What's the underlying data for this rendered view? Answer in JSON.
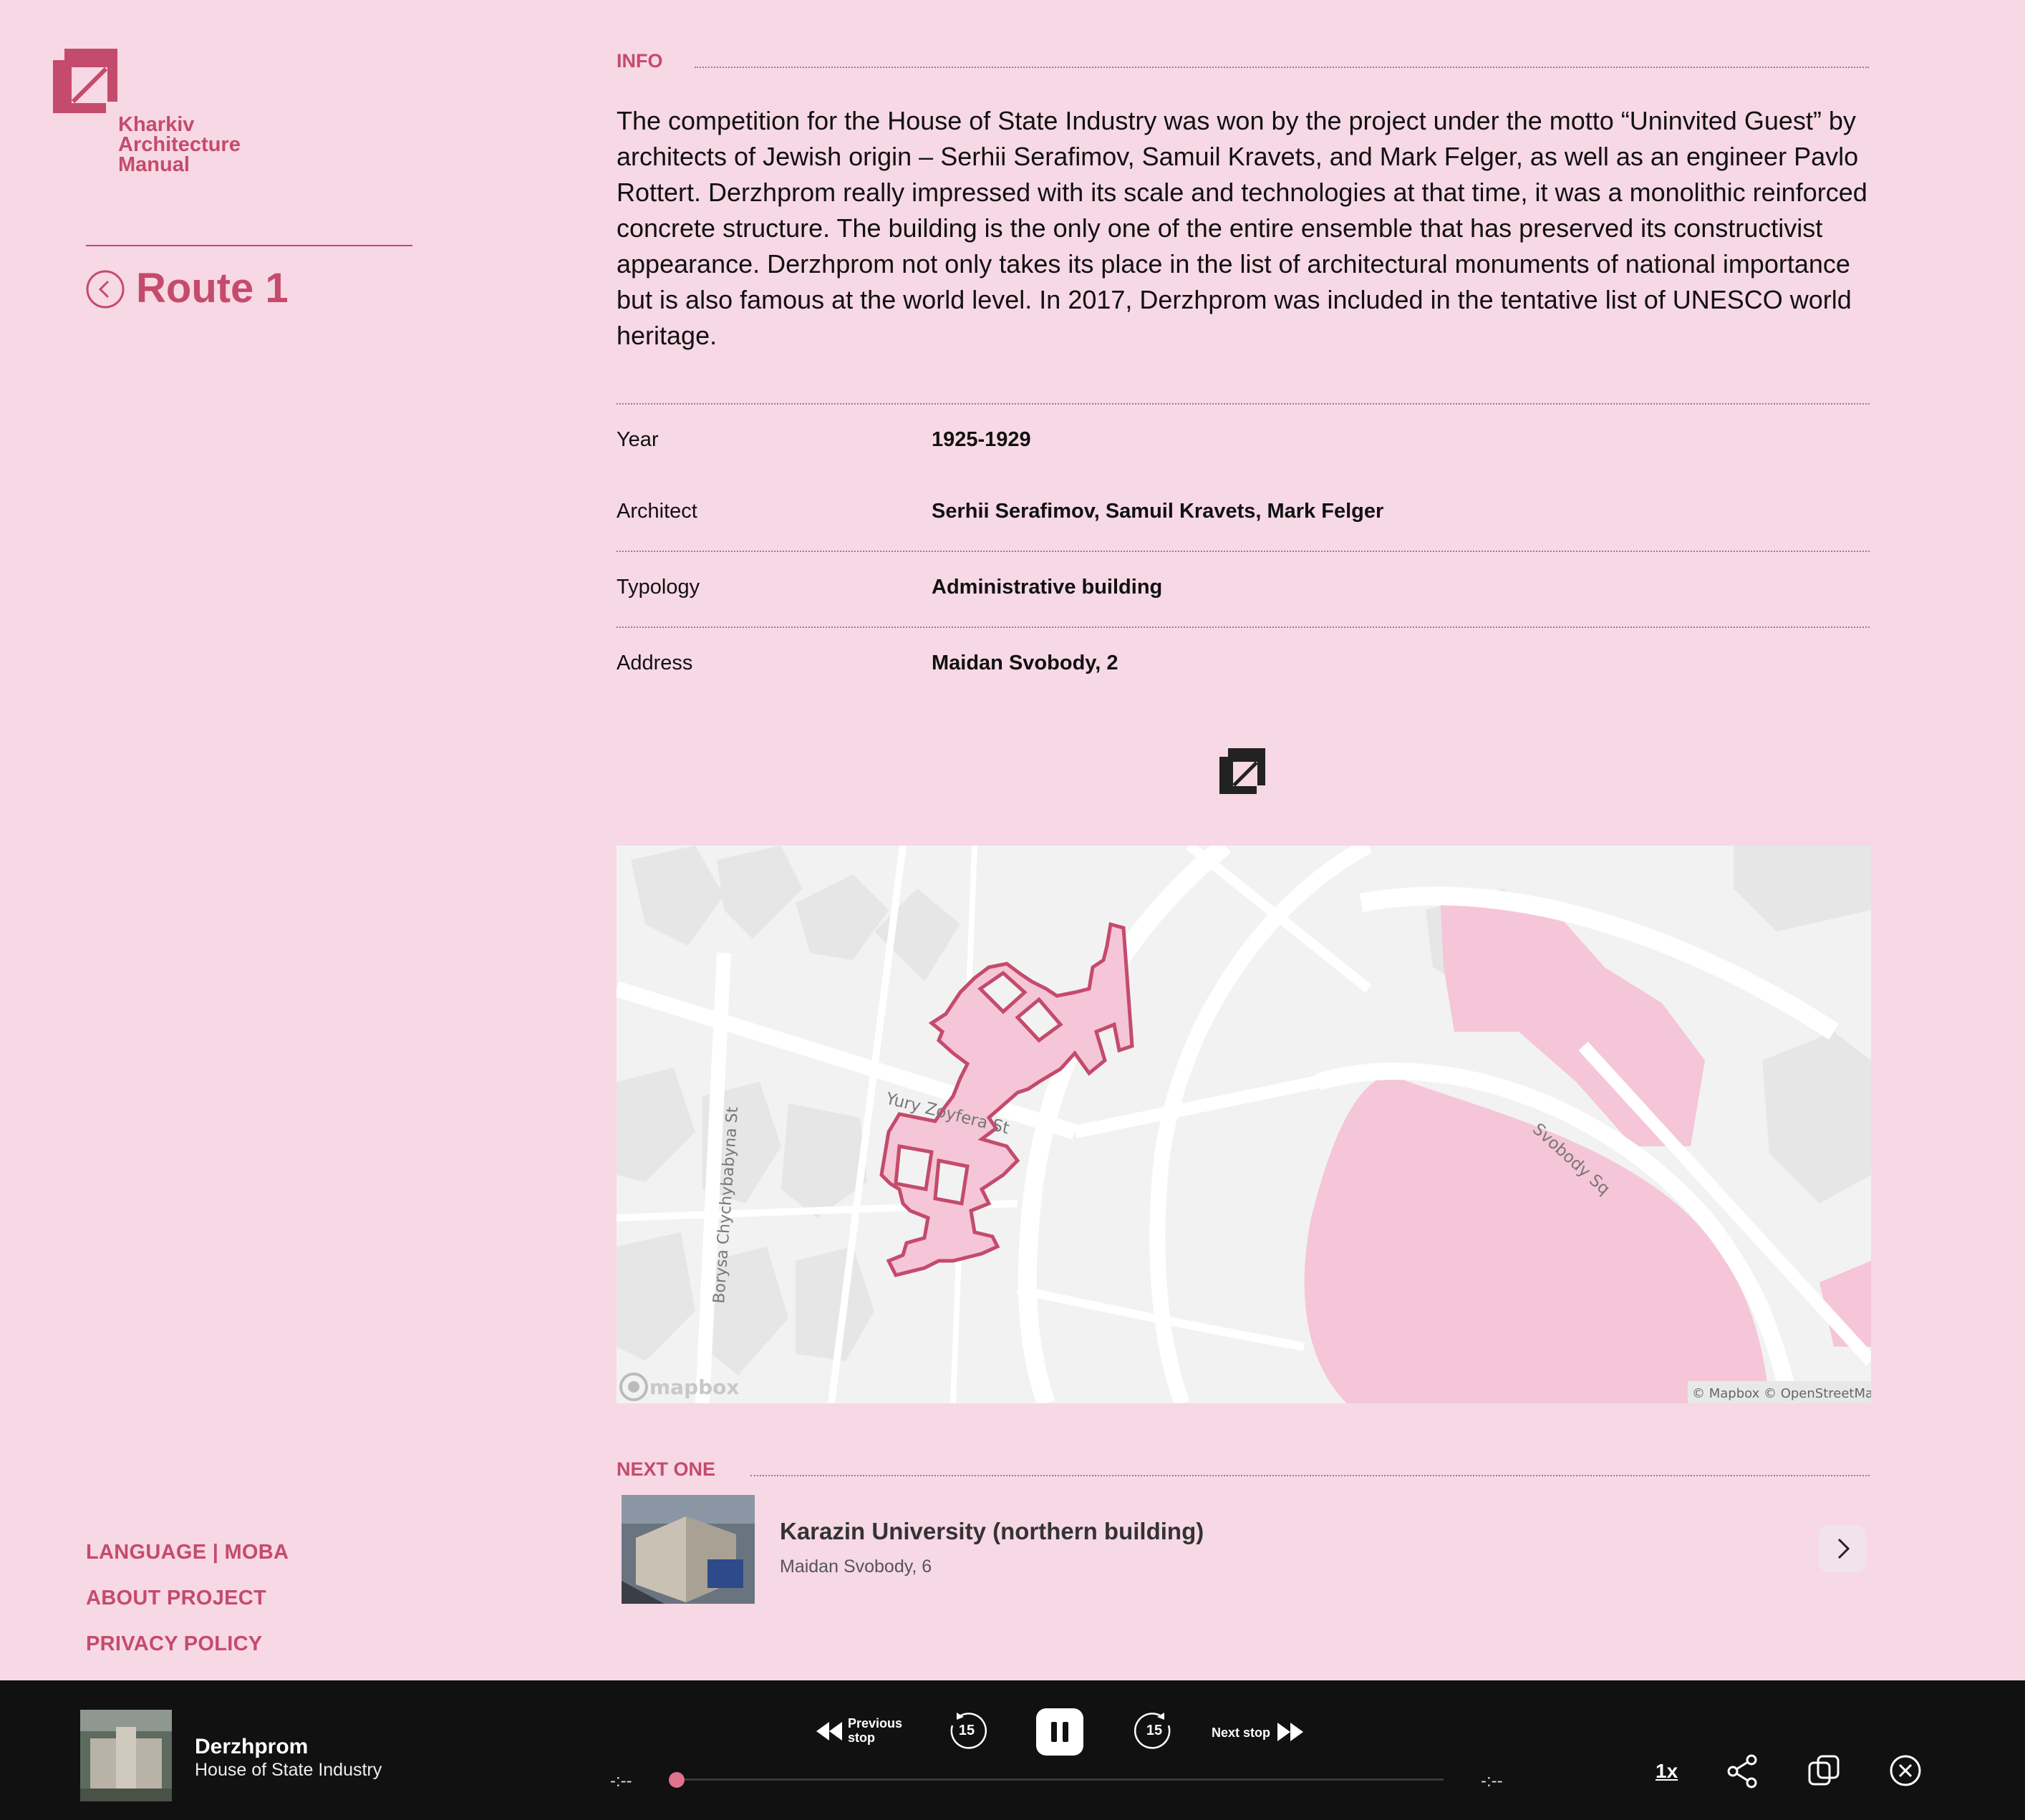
{
  "brand": {
    "logo_lines": [
      "Kharkiv",
      "Architecture",
      "Manual"
    ],
    "accent": "#c44b6c",
    "background": "#f7d8e5"
  },
  "sidebar": {
    "back_icon": "chevron-left-circle-icon",
    "route_title": "Route 1",
    "footer_links": {
      "language": "LANGUAGE | MOBA",
      "about": "ABOUT PROJECT",
      "privacy": "PRIVACY POLICY"
    }
  },
  "info": {
    "label": "INFO",
    "description": "The competition for the House of State Industry was won by the project under the motto “Uninvited Guest” by architects of Jewish origin – Serhii Serafimov, Samuil Kravets, and Mark Felger, as well as an engineer Pavlo Rottert. Derzhprom really impressed with its scale and technologies at that time, it was a monolithic reinforced concrete structure. The building is the only one of the entire ensemble that has preserved its constructivist appearance. Derzhprom not only takes its place in the list of architectural monuments of national importance but is also famous at the world level. In 2017, Derzhprom was included in the tentative list of UNESCO world heritage.",
    "rows": [
      {
        "label": "Year",
        "value": "1925-1929"
      },
      {
        "label": "Architect",
        "value": "Serhii Serafimov, Samuil Kravets, Mark Felger"
      },
      {
        "label": "Typology",
        "value": "Administrative building"
      },
      {
        "label": "Address",
        "value": "Maidan Svobody, 2"
      }
    ]
  },
  "map": {
    "streets": {
      "zoyfera": "Yury Zoyfera St",
      "chychybabyna": "Borysa Chychybabyna St",
      "svobody": "Svobody Sq"
    },
    "provider_logo": "mapbox",
    "attribution": "© Mapbox © OpenStreetMap",
    "highlight_color": "#f5c6d7",
    "outline_color": "#c44b6c"
  },
  "next": {
    "label": "NEXT ONE",
    "title": "Karazin University (northern building)",
    "address": "Maidan Svobody, 6"
  },
  "player": {
    "title": "Derzhprom",
    "subtitle": "House of State Industry",
    "prev_label_1": "Previous",
    "prev_label_2": "stop",
    "rewind": "15",
    "forward": "15",
    "next_label": "Next stop",
    "time_elapsed": "-:--",
    "time_total": "-:--",
    "progress": 0,
    "speed": "1x"
  }
}
